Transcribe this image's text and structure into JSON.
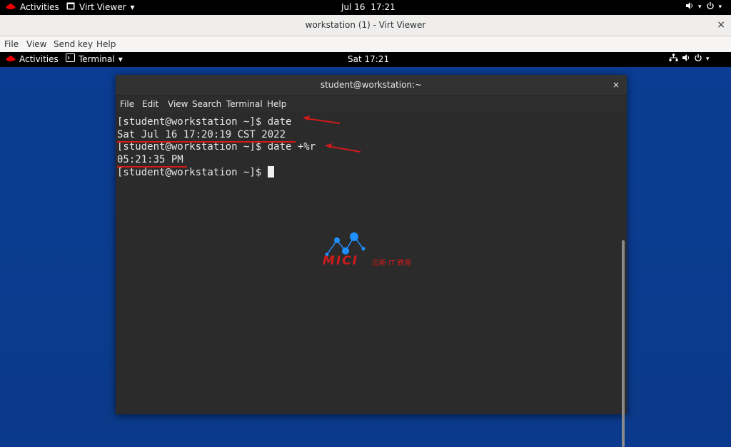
{
  "host_bar": {
    "activities": "Activities",
    "app": "Virt Viewer",
    "clock": "Jul 16  17:21"
  },
  "window": {
    "title": "workstation (1) - Virt Viewer",
    "close": "×"
  },
  "menu": {
    "items": [
      "File",
      "View",
      "Send key",
      "Help"
    ]
  },
  "guest_bar": {
    "activities": "Activities",
    "app": "Terminal",
    "clock": "Sat 17:21"
  },
  "terminal": {
    "title": "student@workstation:~",
    "close": "×",
    "menu": [
      "File",
      "Edit",
      "View",
      "Search",
      "Terminal",
      "Help"
    ],
    "lines": [
      "[student@workstation ~]$ date",
      "Sat Jul 16 17:20:19 CST 2022",
      "[student@workstation ~]$ date +%r",
      "05:21:35 PM",
      "[student@workstation ~]$ "
    ]
  },
  "watermark": {
    "brand": "MICI",
    "subtitle": "迈斯 IT 教育"
  },
  "colors": {
    "annotation_red": "#d11a1a",
    "watermark_blue": "#1e90ff",
    "desktop_blue": "#0a3a8e"
  }
}
